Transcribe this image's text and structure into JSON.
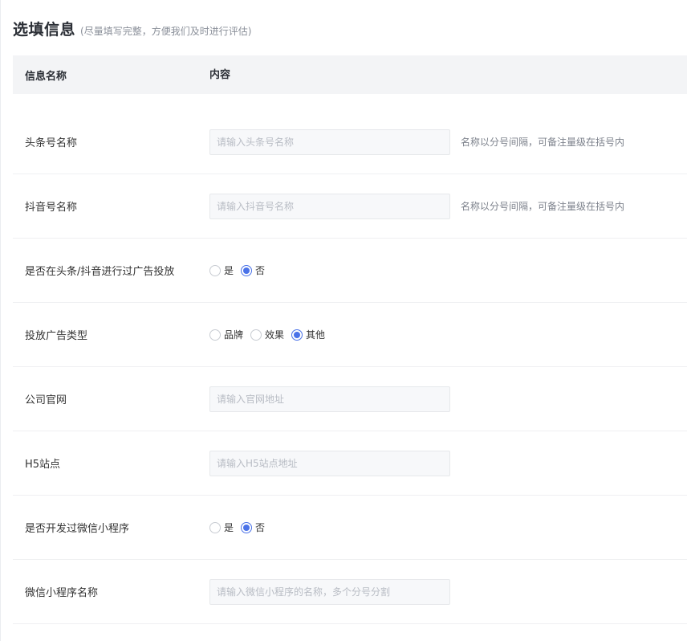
{
  "header": {
    "title": "选填信息",
    "subtitle": "(尽量填写完整，方便我们及时进行评估)"
  },
  "table": {
    "col_name": "信息名称",
    "col_content": "内容"
  },
  "rows": {
    "toutiao": {
      "label": "头条号名称",
      "placeholder": "请输入头条号名称",
      "value": "",
      "hint": "名称以分号间隔，可备注量级在括号内"
    },
    "douyin": {
      "label": "抖音号名称",
      "placeholder": "请输入抖音号名称",
      "value": "",
      "hint": "名称以分号间隔，可备注量级在括号内"
    },
    "advertised": {
      "label": "是否在头条/抖音进行过广告投放",
      "options": [
        "是",
        "否"
      ],
      "selected": "否"
    },
    "ad_type": {
      "label": "投放广告类型",
      "options": [
        "品牌",
        "效果",
        "其他"
      ],
      "selected": "其他"
    },
    "website": {
      "label": "公司官网",
      "placeholder": "请输入官网地址",
      "value": ""
    },
    "h5": {
      "label": "H5站点",
      "placeholder": "请输入H5站点地址",
      "value": ""
    },
    "miniprogram_dev": {
      "label": "是否开发过微信小程序",
      "options": [
        "是",
        "否"
      ],
      "selected": "否"
    },
    "miniprogram_name": {
      "label": "微信小程序名称",
      "placeholder": "请输入微信小程序的名称，多个分号分割",
      "value": ""
    }
  },
  "colors": {
    "accent": "#4a72e8",
    "header_bg": "#f3f4f6",
    "input_bg": "#f7f8fa"
  }
}
